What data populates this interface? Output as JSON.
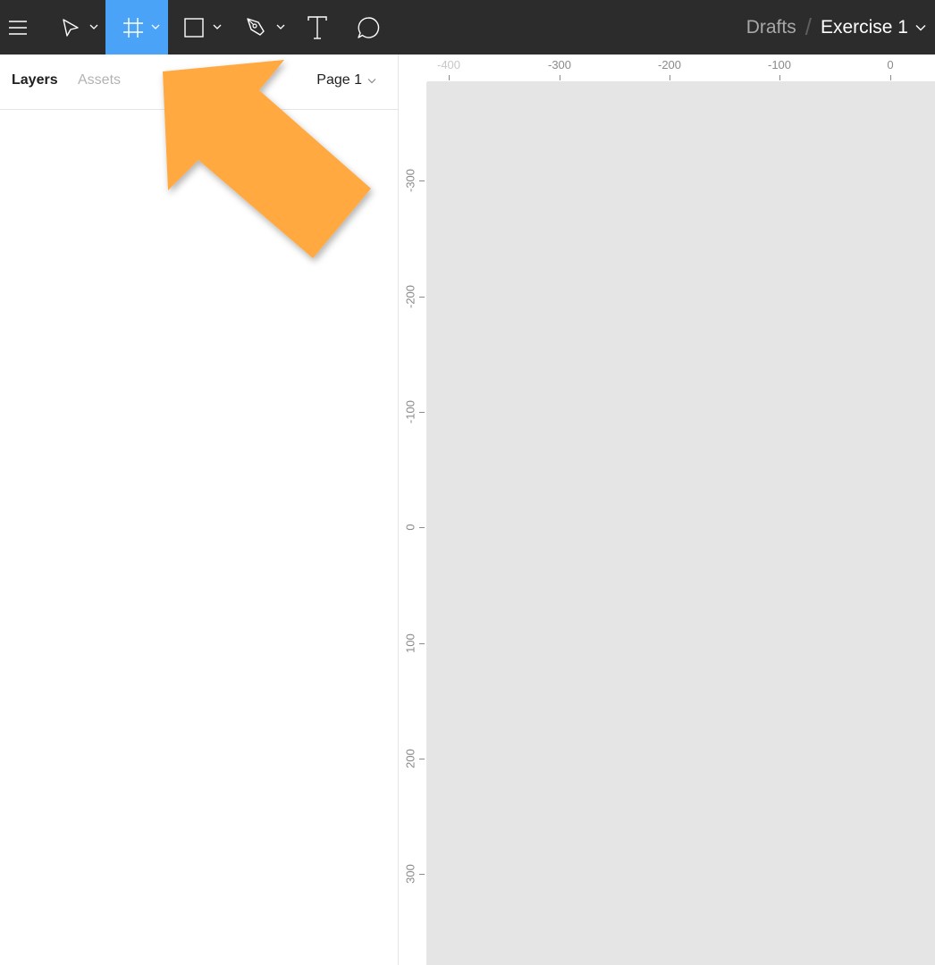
{
  "toolbar": {
    "tools": [
      {
        "name": "main-menu",
        "icon": "hamburger-icon",
        "active": false
      },
      {
        "name": "move-tool",
        "icon": "cursor-arrow-icon",
        "active": false,
        "has_dropdown": true
      },
      {
        "name": "frame-tool",
        "icon": "frame-hash-icon",
        "active": true,
        "has_dropdown": true
      },
      {
        "name": "shape-tool",
        "icon": "rectangle-icon",
        "active": false,
        "has_dropdown": true
      },
      {
        "name": "pen-tool",
        "icon": "pen-icon",
        "active": false,
        "has_dropdown": true
      },
      {
        "name": "text-tool",
        "icon": "text-icon",
        "active": false
      },
      {
        "name": "comment-tool",
        "icon": "comment-bubble-icon",
        "active": false
      }
    ],
    "breadcrumb": {
      "parent": "Drafts",
      "separator": "/",
      "current": "Exercise 1"
    }
  },
  "left_panel": {
    "tabs": [
      {
        "label": "Layers",
        "active": true
      },
      {
        "label": "Assets",
        "active": false
      }
    ],
    "page_selector": "Page 1"
  },
  "rulers": {
    "horizontal": [
      "-400",
      "-300",
      "-200",
      "-100",
      "0"
    ],
    "vertical": [
      "-300",
      "-200",
      "-100",
      "0",
      "100",
      "200",
      "300"
    ]
  },
  "colors": {
    "toolbar_bg": "#2c2c2c",
    "active_tool": "#4ba3f7",
    "canvas_bg": "#e5e5e5",
    "annotation_arrow": "#ffa940"
  }
}
